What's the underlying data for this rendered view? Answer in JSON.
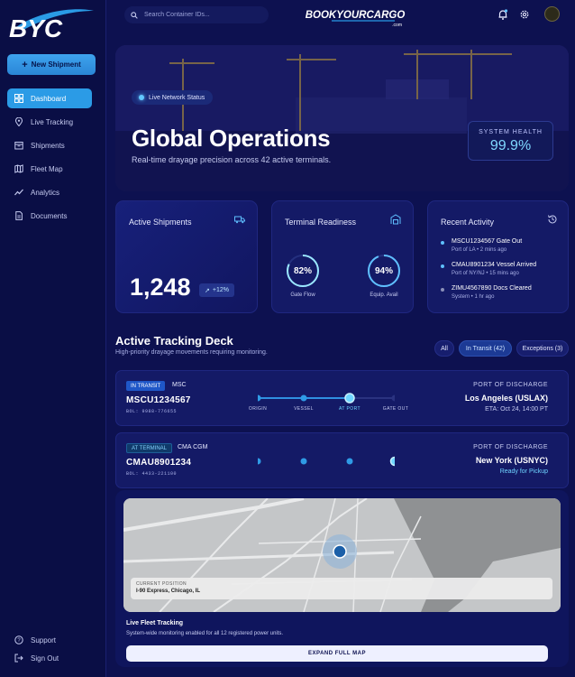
{
  "sidebar": {
    "logo_text": "BYC",
    "new_button": "New Shipment",
    "items": [
      {
        "label": "Dashboard",
        "icon": "dashboard-icon",
        "active": true
      },
      {
        "label": "Live Tracking",
        "icon": "location-pin-icon"
      },
      {
        "label": "Shipments",
        "icon": "box-icon"
      },
      {
        "label": "Fleet Map",
        "icon": "map-icon"
      },
      {
        "label": "Analytics",
        "icon": "chart-icon"
      },
      {
        "label": "Documents",
        "icon": "document-icon"
      }
    ],
    "support": "Support",
    "sign_out": "Sign Out"
  },
  "topbar": {
    "search_placeholder": "Search Container IDs...",
    "brand": "BOOKYOURCARGO",
    "brand_sub": ".com"
  },
  "hero": {
    "pill": "Live Network Status",
    "title": "Global Operations",
    "subtitle": "Real-time drayage precision across 42 active terminals.",
    "health_label": "SYSTEM HEALTH",
    "health_value": "99.9%"
  },
  "cards": {
    "active": {
      "title": "Active Shipments",
      "value": "1,248",
      "growth": "+12%"
    },
    "readiness": {
      "title": "Terminal Readiness",
      "gauges": [
        {
          "value": "82%",
          "label": "Gate Flow",
          "fraction": 0.82
        },
        {
          "value": "94%",
          "label": "Equip. Avail",
          "fraction": 0.94
        }
      ]
    },
    "activity": {
      "title": "Recent Activity",
      "items": [
        {
          "title": "MSCU1234567 Gate Out",
          "sub": "Port of LA • 2 mins ago",
          "color": "#5fc0ff"
        },
        {
          "title": "CMAU8901234 Vessel Arrived",
          "sub": "Port of NY/NJ • 15 mins ago",
          "color": "#5fc0ff"
        },
        {
          "title": "ZIMU4567890 Docs Cleared",
          "sub": "System • 1 hr ago",
          "color": "#8a8fb8"
        }
      ]
    }
  },
  "deck": {
    "title": "Active Tracking Deck",
    "subtitle": "High-priority drayage movements requiring monitoring.",
    "filters": [
      "All",
      "In Transit (42)",
      "Exceptions (3)"
    ],
    "shipments": [
      {
        "status": "IN TRANSIT",
        "carrier": "MSC",
        "id": "MSCU1234567",
        "bol": "BOL: 9988-776655",
        "port_label": "PORT OF DISCHARGE",
        "port": "Los Angeles (USLAX)",
        "extra": "ETA: Oct 24, 14:00 PT",
        "stages": [
          "ORIGIN",
          "VESSEL",
          "AT PORT",
          "GATE OUT"
        ]
      },
      {
        "status": "AT TERMINAL",
        "carrier": "CMA CGM",
        "id": "CMAU8901234",
        "bol": "BOL: 4433-221100",
        "port_label": "PORT OF DISCHARGE",
        "port": "New York (USNYC)",
        "extra": "Ready for Pickup"
      }
    ]
  },
  "map": {
    "current_label": "CURRENT POSITION",
    "current_value": "I-90 Express, Chicago, IL",
    "fleet_title": "Live Fleet Tracking",
    "fleet_sub": "System-wide monitoring enabled for all 12 registered power units.",
    "expand": "EXPAND FULL MAP"
  }
}
